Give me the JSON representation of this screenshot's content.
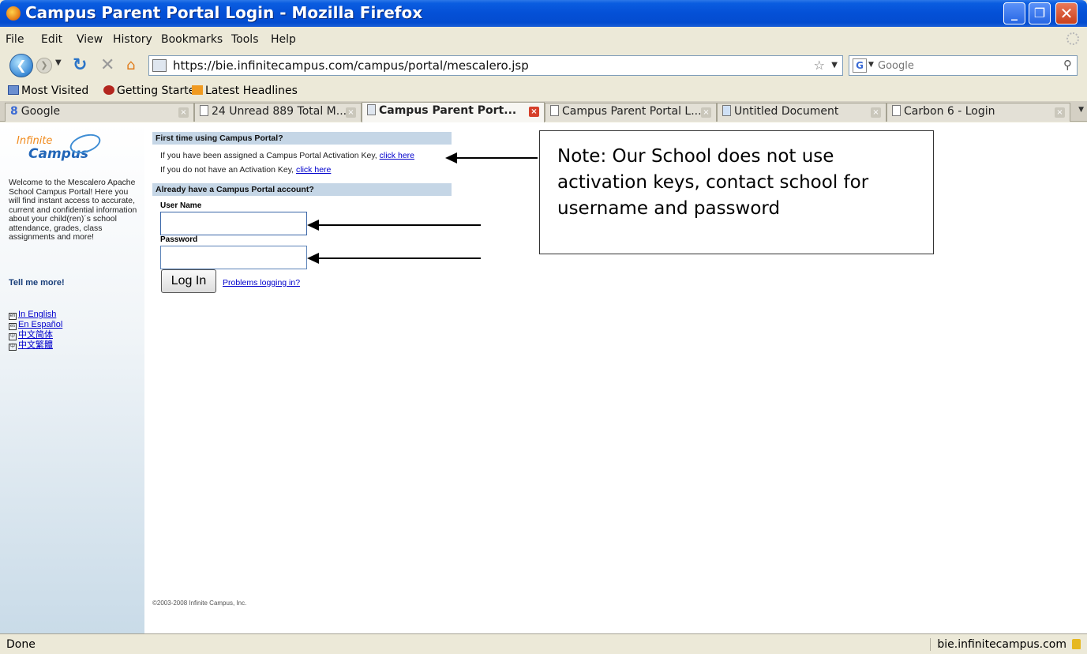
{
  "window": {
    "title": "Campus Parent Portal Login - Mozilla Firefox",
    "min_glyph": "_",
    "max_glyph": "❐",
    "close_glyph": "✕"
  },
  "menu": [
    "File",
    "Edit",
    "View",
    "History",
    "Bookmarks",
    "Tools",
    "Help"
  ],
  "nav": {
    "url": "https://bie.infinitecampus.com/campus/portal/mescalero.jsp",
    "search_placeholder": "Google"
  },
  "bookmarks": [
    "Most Visited",
    "Getting Started",
    "Latest Headlines"
  ],
  "tabs": [
    {
      "label": "Google"
    },
    {
      "label": "24 Unread 889 Total M..."
    },
    {
      "label": "Campus Parent Port..."
    },
    {
      "label": "Campus Parent Portal L..."
    },
    {
      "label": "Untitled Document"
    },
    {
      "label": "Carbon 6 - Login"
    }
  ],
  "sidebar": {
    "logo_top": "Infinite",
    "logo_bottom": "Campus",
    "welcome": "Welcome to the Mescalero Apache School Campus Portal! Here you will find instant access to accurate, current and confidential information about your child(ren)´s school attendance, grades, class assignments and more!",
    "tell_more": "Tell me more!",
    "languages": [
      {
        "code": "en",
        "label": "In English"
      },
      {
        "code": "es",
        "label": "En Español"
      },
      {
        "code": "中",
        "label": "中文简体"
      },
      {
        "code": "中",
        "label": "中文繁體"
      }
    ]
  },
  "login": {
    "first_time_header": "First time using Campus Portal?",
    "key_text": "If you have been assigned a Campus Portal Activation Key,",
    "no_key_text": "If you do not have an Activation Key,",
    "click_here": "click here",
    "account_header": "Already have a Campus Portal account?",
    "username_label": "User Name",
    "password_label": "Password",
    "login_button": "Log In",
    "problems_link": "Problems logging in?",
    "copyright": "©2003-2008 Infinite Campus, Inc."
  },
  "annotation": {
    "note": "Note: Our School does not use activation keys, contact school for username and password"
  },
  "status": {
    "text": "Done",
    "host": "bie.infinitecampus.com"
  }
}
